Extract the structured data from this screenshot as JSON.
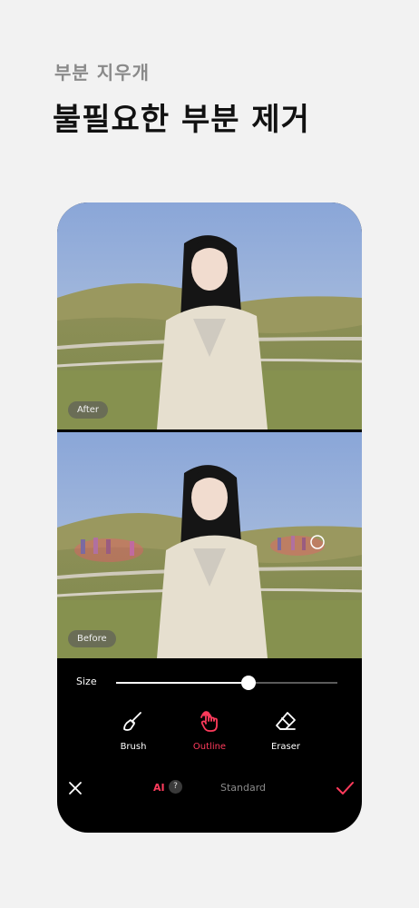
{
  "header": {
    "subtitle": "부분 지우개",
    "title": "불필요한 부분 제거"
  },
  "preview": {
    "after_label": "After",
    "before_label": "Before"
  },
  "size_control": {
    "label": "Size",
    "value_fraction": 0.6
  },
  "tools": [
    {
      "label": "Brush",
      "icon": "brush-icon",
      "active": false
    },
    {
      "label": "Outline",
      "icon": "touch-icon",
      "active": true
    },
    {
      "label": "Eraser",
      "icon": "eraser-icon",
      "active": false
    }
  ],
  "bottom_bar": {
    "mode_ai": "AI",
    "help": "?",
    "mode_standard": "Standard"
  },
  "colors": {
    "accent": "#ff3b5c",
    "background": "#f2f2f2",
    "panel": "#000000"
  }
}
